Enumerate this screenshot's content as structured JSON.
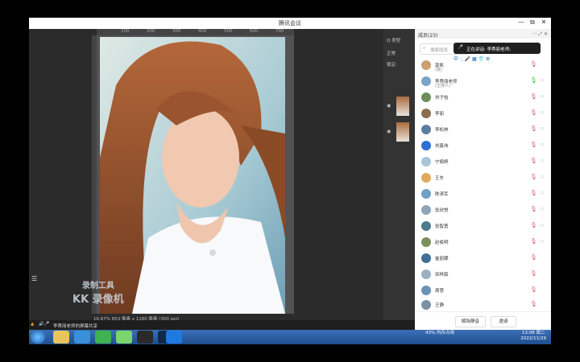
{
  "window": {
    "title": "腾讯会议",
    "minimize": "—",
    "restore": "⧉",
    "close": "✕"
  },
  "ps": {
    "ruler_ticks": [
      "0",
      "100",
      "200",
      "300",
      "400",
      "500",
      "600",
      "700"
    ],
    "status": "16.67%   853 像素 x 1280 像素 (300 ppi)",
    "panel": {
      "kind": "Q 类型",
      "mode": "正常",
      "lock": "锁定:"
    }
  },
  "watermark": {
    "line1": "录制工具",
    "line2": "KK 录像机"
  },
  "meeting": {
    "header": "成员(23)",
    "header_icons": "··· ⤢ ✕",
    "search_placeholder": "搜索成员",
    "speaking": "正在讲话: 李秀丽老师;",
    "mini_toolbar": "中 ·, 🎤 ▦ 👕 ⚙",
    "members": [
      {
        "name": "郭凯",
        "sub": "(我)",
        "color": "#c9a06e"
      },
      {
        "name": "李秀丽老师",
        "sub": "(主持人)",
        "color": "#7aa3c8"
      },
      {
        "name": "刘子怡",
        "sub": "",
        "color": "#6b8e5a"
      },
      {
        "name": "李丽",
        "sub": "",
        "color": "#8a6d4e"
      },
      {
        "name": "李松林",
        "sub": "",
        "color": "#5d7f9e"
      },
      {
        "name": "刘鑫伟",
        "sub": "",
        "color": "#2d6fd3"
      },
      {
        "name": "宁婉婷",
        "sub": "",
        "color": "#a7c4d9"
      },
      {
        "name": "王东",
        "sub": "",
        "color": "#e0a95c"
      },
      {
        "name": "陈涛军",
        "sub": "",
        "color": "#6fa0c6"
      },
      {
        "name": "张欣悦",
        "sub": "",
        "color": "#8fa4b9"
      },
      {
        "name": "张智勇",
        "sub": "",
        "color": "#4e7a8f"
      },
      {
        "name": "赵俊明",
        "sub": "",
        "color": "#7c8e5b"
      },
      {
        "name": "崔丽娜",
        "sub": "",
        "color": "#3e6f95"
      },
      {
        "name": "宋梓宸",
        "sub": "",
        "color": "#9bb0c4"
      },
      {
        "name": "周慧",
        "sub": "",
        "color": "#6a92b6"
      },
      {
        "name": "王静",
        "sub": "",
        "color": "#7c8fa3"
      }
    ],
    "footer": {
      "mute_all": "解除静音",
      "invite": "邀请"
    }
  },
  "recbar": {
    "text": "李秀丽老师的屏幕共享"
  },
  "taskbar": {
    "apps": [
      "start",
      "explorer",
      "browser",
      "ie",
      "wechat",
      "avatar",
      "photoshop",
      "meeting"
    ],
    "network": "43%\n内存占用",
    "time": "13:08 周二",
    "date": "2022/11/29"
  }
}
